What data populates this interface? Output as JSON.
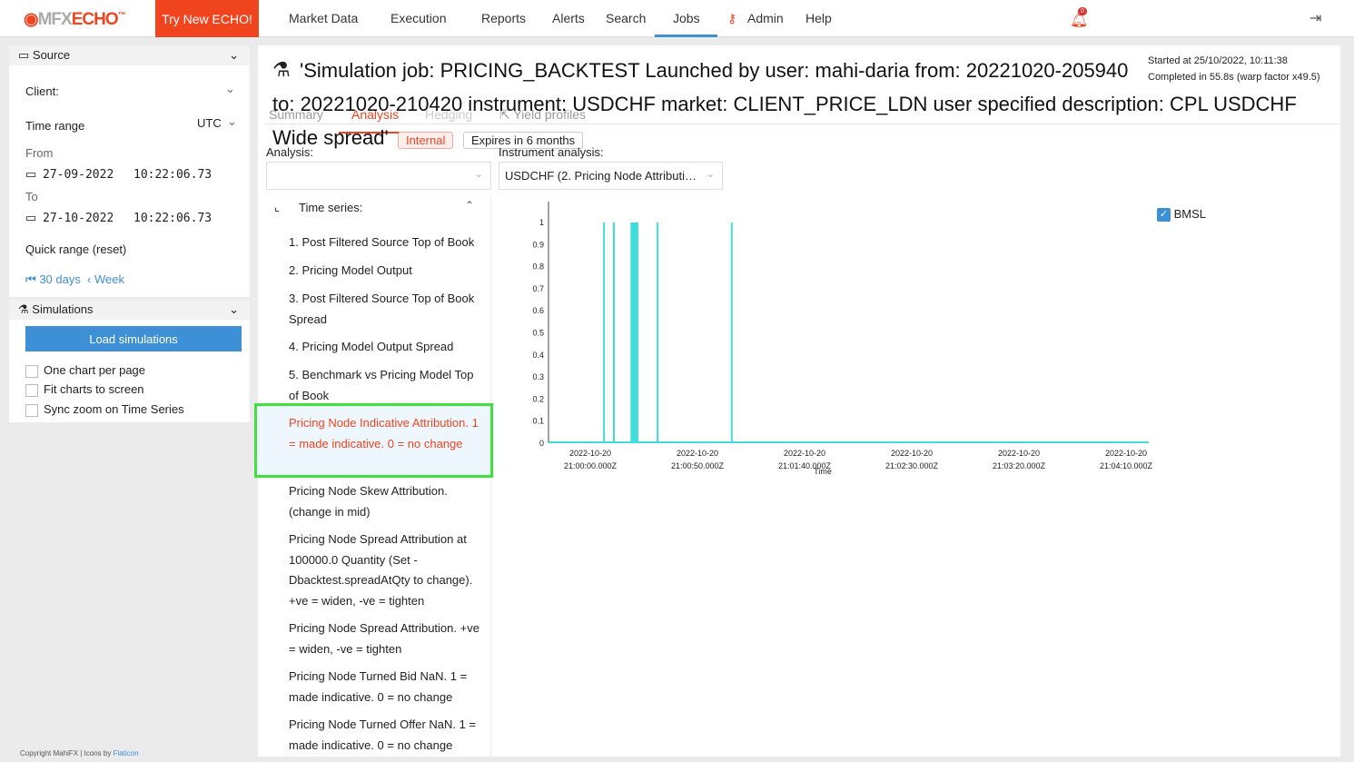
{
  "nav": {
    "logo_a": "MFX",
    "logo_b": "ECHO",
    "logo_tm": "™",
    "try": "Try New ECHO!",
    "items": [
      "Market Data",
      "Execution",
      "Reports",
      "Alerts",
      "Search",
      "Jobs",
      "Admin",
      "Help"
    ],
    "active": "Jobs",
    "notif_count": "0"
  },
  "sidebar": {
    "source": "Source",
    "client": "Client:",
    "time_range": "Time range",
    "tz": "UTC",
    "from": "From",
    "from_date": "27-09-2022",
    "from_time": "10:22:06.73",
    "to": "To",
    "to_date": "27-10-2022",
    "to_time": "10:22:06.73",
    "quick_range": "Quick range (reset)",
    "q1": "30 days",
    "q2": "Week",
    "simulations": "Simulations",
    "load": "Load simulations",
    "checks": [
      "One chart per page",
      "Fit charts to screen",
      "Sync zoom on Time Series"
    ],
    "copyright": "Copyright MahiFX | Icons by ",
    "flaticon": "Flaticon"
  },
  "job": {
    "title_l1": "'Simulation job: PRICING_BACKTEST Launched by user: mahi-daria from: 20221020-205940",
    "title_l2": "to: 20221020-210420 instrument: USDCHF market: CLIENT_PRICE_LDN user specified description: CPL USDCHF",
    "title_l3": "Wide spread'",
    "started": "Started at 25/10/2022, 10:11:38",
    "completed": "Completed in 55.8s (warp factor x49.5)",
    "tag_internal": "Internal",
    "tag_expires": "Expires in 6 months"
  },
  "tabs": [
    "Summary",
    "Analysis",
    "Hedging",
    "Yield profiles"
  ],
  "active_tab": "Analysis",
  "analysis_label": "Analysis:",
  "analysis_value": "",
  "instrument_label": "Instrument analysis:",
  "instrument_value": "USDCHF (2. Pricing Node Attributi…",
  "time_series": {
    "header": "Time series:",
    "items": [
      "1. Post Filtered Source Top of Book",
      "2. Pricing Model Output",
      "3. Post Filtered Source Top of Book Spread",
      "4. Pricing Model Output Spread",
      "5. Benchmark vs Pricing Model Top of Book",
      "Pricing Node Indicative Attribution. 1 = made indicative. 0 = no change",
      "Pricing Node Skew Attribution. (change in mid)",
      "Pricing Node Spread Attribution at 100000.0 Quantity (Set -Dbacktest.spreadAtQty to change). +ve = widen, -ve = tighten",
      "Pricing Node Spread Attribution. +ve = widen, -ve = tighten",
      "Pricing Node Turned Bid NaN. 1 = made indicative. 0 = no change",
      "Pricing Node Turned Offer NaN. 1 = made indicative. 0 = no change"
    ],
    "selected": 5,
    "selected_color": "#f0441f"
  },
  "chart_data": {
    "type": "line",
    "xlabel": "Time",
    "ylabel": "",
    "ylim": [
      0,
      1
    ],
    "xlim": [
      "2022-10-20 20:59:40.5Z",
      "2022-10-20 21:04:20.6Z"
    ],
    "yticks": [
      "0",
      "0.1",
      "0.2",
      "0.3",
      "0.4",
      "0.5",
      "0.6",
      "0.7",
      "0.8",
      "0.9",
      "1"
    ],
    "xticks": [
      [
        "2022-10-20",
        "21:00:00.000Z"
      ],
      [
        "2022-10-20",
        "21:00:50.000Z"
      ],
      [
        "2022-10-20",
        "21:01:40.000Z"
      ],
      [
        "2022-10-20",
        "21:02:30.000Z"
      ],
      [
        "2022-10-20",
        "21:03:20.000Z"
      ],
      [
        "2022-10-20",
        "21:04:10.000Z"
      ]
    ],
    "series": [
      {
        "name": "BMSL",
        "color": "#3fdcdc",
        "pulses": [
          [
            "21:00:06.4Z",
            "21:00:06.4Z"
          ],
          [
            "21:00:11.0Z",
            "21:00:11.0Z"
          ],
          [
            "21:00:19.2Z",
            "21:00:22.0Z"
          ],
          [
            "21:00:31.4Z",
            "21:00:31.4Z"
          ],
          [
            "21:01:06.0Z",
            "21:01:06.0Z"
          ]
        ],
        "baseline": 0,
        "peak": 1
      }
    ],
    "legend": "top-right",
    "grid": false
  }
}
